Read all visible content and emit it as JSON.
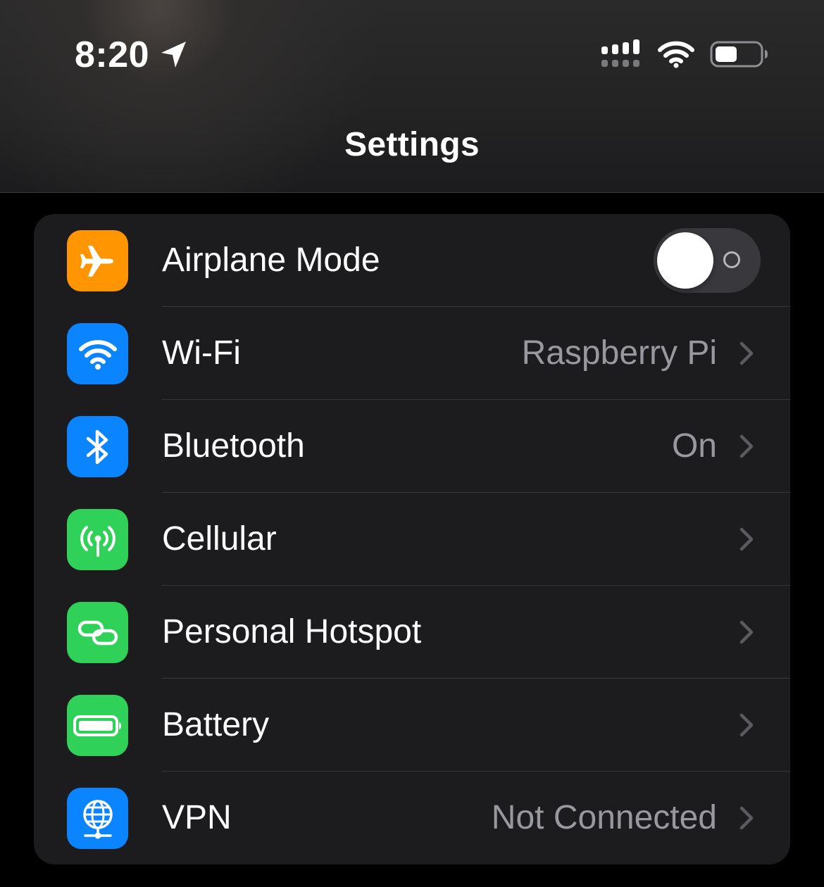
{
  "status_bar": {
    "time": "8:20",
    "location_icon": "location-arrow-icon",
    "cellular_icon": "cellular-signal-icon",
    "wifi_icon": "wifi-signal-icon",
    "battery_icon": "battery-icon",
    "battery_level": 0.5
  },
  "header": {
    "title": "Settings"
  },
  "settings": {
    "rows": [
      {
        "label": "Airplane Mode",
        "icon": "airplane-icon",
        "icon_color": "#ff9500",
        "toggle": true,
        "toggle_on": false
      },
      {
        "label": "Wi-Fi",
        "value": "Raspberry Pi",
        "icon": "wifi-icon",
        "icon_color": "#0a84ff"
      },
      {
        "label": "Bluetooth",
        "value": "On",
        "icon": "bluetooth-icon",
        "icon_color": "#0a84ff"
      },
      {
        "label": "Cellular",
        "icon": "antenna-icon",
        "icon_color": "#30d158"
      },
      {
        "label": "Personal Hotspot",
        "icon": "hotspot-link-icon",
        "icon_color": "#30d158"
      },
      {
        "label": "Battery",
        "icon": "battery-icon",
        "icon_color": "#30d158"
      },
      {
        "label": "VPN",
        "value": "Not Connected",
        "icon": "vpn-globe-icon",
        "icon_color": "#0a84ff"
      }
    ]
  },
  "colors": {
    "background": "#000000",
    "group_background": "#1c1c1e",
    "secondary_text": "#98989f",
    "separator": "#38383a"
  }
}
